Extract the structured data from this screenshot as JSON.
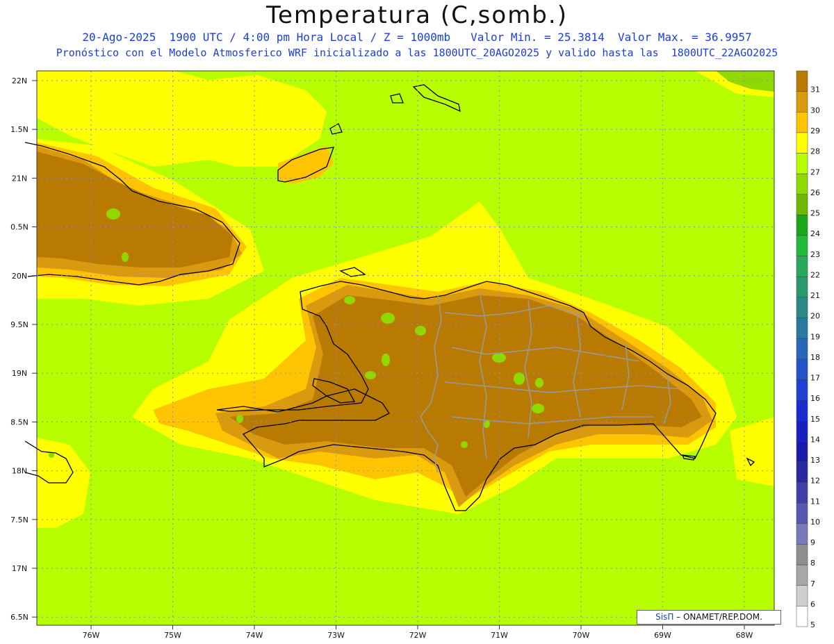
{
  "title": "Temperatura (C,somb.)",
  "subtitle1": "20-Ago-2025  1900 UTC / 4:00 pm Hora Local / Z = 1000mb   Valor Min. = 25.3814  Valor Max. = 36.9957",
  "subtitle2": "Pronóstico con el Modelo Atmosferico WRF inicializado a las 1800UTC_20AGO2025 y valido hasta las  1800UTC_22AGO2025",
  "lat_ticks": [
    "22N",
    "1.5N",
    "21N",
    "0.5N",
    "20N",
    "9.5N",
    "19N",
    "8.5N",
    "18N",
    "7.5N",
    "17N",
    "6.5N"
  ],
  "lon_ticks": [
    "76W",
    "75W",
    "74W",
    "73W",
    "72W",
    "71W",
    "70W",
    "69W",
    "68W"
  ],
  "colorbar": {
    "labels": [
      "31",
      "30",
      "29",
      "28",
      "27",
      "26",
      "25",
      "24",
      "23",
      "22",
      "21",
      "20",
      "19",
      "18",
      "17",
      "16",
      "15",
      "14",
      "13",
      "12",
      "11",
      "10",
      "9",
      "8",
      "7",
      "6",
      "5"
    ],
    "colors": [
      "#b87a00",
      "#d99a10",
      "#ffc400",
      "#ffff00",
      "#b7ff00",
      "#8fd900",
      "#6fb800",
      "#1aa81a",
      "#22b83c",
      "#27a85a",
      "#2a9a6e",
      "#2a8a86",
      "#2a7aa0",
      "#2766b8",
      "#2452c8",
      "#1f3ed4",
      "#1a2cd0",
      "#1a1fc0",
      "#1a1aa8",
      "#2828a0",
      "#4040a8",
      "#5858b0",
      "#7a7ab8",
      "#8f8f8f",
      "#a8a8a8",
      "#cfcfcf",
      "#ffffff"
    ]
  },
  "credit": {
    "brand": "SisΠ",
    "org": "– ONAMET/REP.DOM."
  },
  "palette": {
    "sea_base": "#b7ff00",
    "warm_sea": "#ffff00",
    "warmer": "#ffc400",
    "hot": "#d99a10",
    "hottest": "#b87a00",
    "cool_spot": "#8fd900",
    "coast": "#000000",
    "border": "#9a9a9a",
    "grid": "#8a8ad8"
  }
}
